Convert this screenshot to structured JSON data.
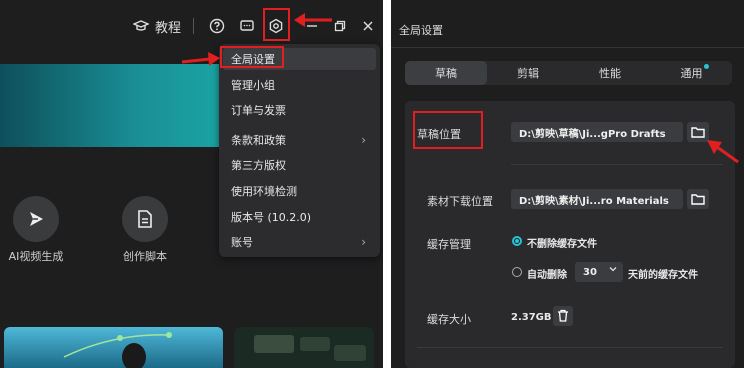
{
  "left": {
    "topbar": {
      "tutorial_label": "教程"
    },
    "tools": [
      {
        "label": "AI视频生成",
        "icon": "send-icon"
      },
      {
        "label": "创作脚本",
        "icon": "document-icon"
      }
    ],
    "menu": {
      "items": [
        {
          "label": "全局设置",
          "has_submenu": false
        },
        {
          "label": "管理小组",
          "has_submenu": false
        },
        {
          "label": "订单与发票",
          "has_submenu": false
        },
        {
          "label": "条款和政策",
          "has_submenu": true
        },
        {
          "label": "第三方版权",
          "has_submenu": false
        },
        {
          "label": "使用环境检测",
          "has_submenu": false
        },
        {
          "label": "版本号 (10.2.0)",
          "has_submenu": false
        },
        {
          "label": "账号",
          "has_submenu": true
        }
      ]
    }
  },
  "right": {
    "title": "全局设置",
    "tabs": [
      {
        "label": "草稿",
        "active": true
      },
      {
        "label": "剪辑",
        "active": false
      },
      {
        "label": "性能",
        "active": false
      },
      {
        "label": "通用",
        "active": false,
        "badge_dot": true
      }
    ],
    "draft_location": {
      "label": "草稿位置",
      "value": "D:\\剪映\\草稿\\Ji...gPro Drafts"
    },
    "material_location": {
      "label": "素材下载位置",
      "value": "D:\\剪映\\素材\\Ji...ro Materials"
    },
    "cache": {
      "label": "缓存管理",
      "option_keep": "不删除缓存文件",
      "option_auto": "自动删除",
      "days_value": "30",
      "days_suffix": "天前的缓存文件"
    },
    "cache_size": {
      "label": "缓存大小",
      "value": "2.37GB"
    }
  },
  "colors": {
    "accent": "#27c4d6",
    "highlight": "#e02020",
    "panel": "#1e1e1f"
  }
}
